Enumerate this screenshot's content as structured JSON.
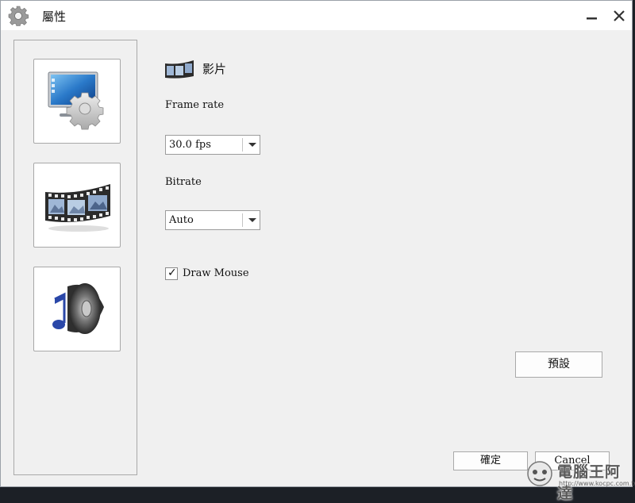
{
  "window": {
    "title": "屬性",
    "icon": "gear-icon",
    "controls": [
      "minimize-icon",
      "close-icon"
    ]
  },
  "sidebar": {
    "items": [
      {
        "icon": "monitor-settings-icon",
        "selected": false
      },
      {
        "icon": "film-strip-icon",
        "selected": true
      },
      {
        "icon": "speaker-music-icon",
        "selected": false
      }
    ]
  },
  "section": {
    "title": "影片",
    "icon": "film-strip-icon"
  },
  "frame_rate": {
    "label": "Frame rate",
    "value": "30.0 fps"
  },
  "bitrate": {
    "label": "Bitrate",
    "value": "Auto"
  },
  "draw_mouse": {
    "label": "Draw Mouse",
    "checked": true,
    "mark": "✓"
  },
  "buttons": {
    "default": "預設",
    "ok": "確定",
    "cancel": "Cancel"
  },
  "watermark": {
    "text": "電腦王阿達",
    "url": "http://www.kocpc.com.tw"
  },
  "colors": {
    "window_bg": "#f0f0f0",
    "titlebar_bg": "#ffffff",
    "desktop_bg": "#1c2026"
  }
}
